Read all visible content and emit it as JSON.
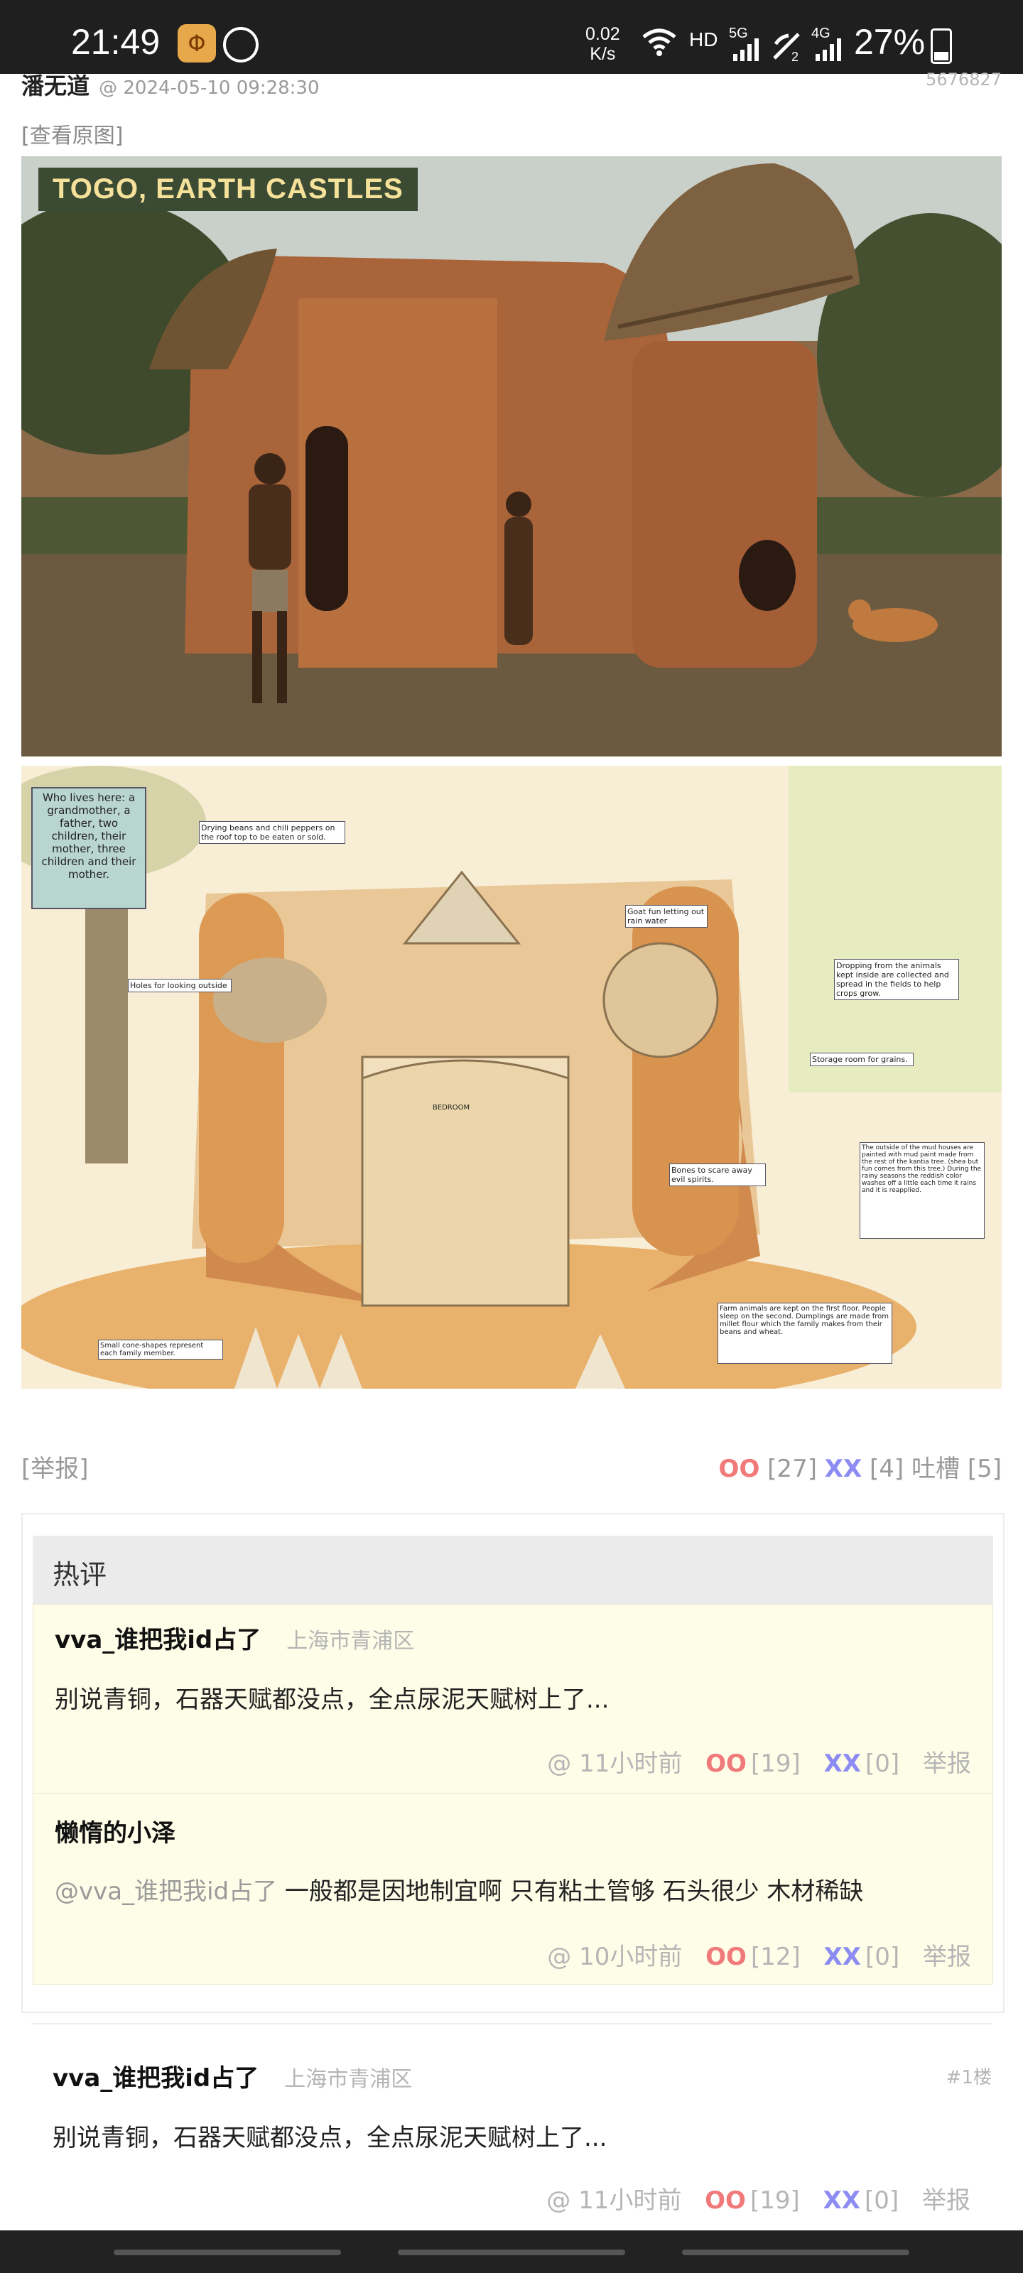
{
  "status_bar": {
    "time": "21:49",
    "net_speed_value": "0.02",
    "net_speed_unit": "K/s",
    "hd": "HD",
    "net_5g": "5G",
    "net_4g": "4G",
    "battery": "27%",
    "battery_level": 0.27
  },
  "post": {
    "author": "潘无道",
    "timestamp": "@ 2024-05-10 09:28:30",
    "post_id": "5676827",
    "view_original": "[查看原图]",
    "image_label": "TOGO, EARTH CASTLES"
  },
  "illustration": {
    "note_family": "Who lives here: a grandmother, a father, two children, their mother, three children and their mother.",
    "note_drying": "Drying beans and chili peppers on the roof top to be eaten or sold.",
    "note_holes": "Holes for looking outside",
    "note_goat": "Goat fun letting out rain water",
    "note_dropping": "Dropping from the animals kept inside are collected and spread in the fields to help crops grow.",
    "note_storage": "Storage room for grains.",
    "note_bedroom": "BEDROOM",
    "note_bones": "Bones to scare away evil spirits.",
    "note_outside": "The outside of the mud houses are painted with mud paint made from the rest of the kantia tree. (shea but fun comes from this tree.) During the rainy seasons the reddish color washes off a little each time it rains and it is reapplied.",
    "note_farm": "Farm animals are kept on the first floor. People sleep on the second. Dumplings are made from millet flour which the family makes from their beans and wheat.",
    "note_small": "Small cone-shapes represent each family member."
  },
  "actions": {
    "report": "[举报]",
    "oo_label": "OO",
    "oo_count": "[27]",
    "xx_label": "XX",
    "xx_count": "[4]",
    "tucao_label": "吐槽",
    "tucao_count": "[5]"
  },
  "hot_comments": {
    "title": "热评",
    "items": [
      {
        "author": "vva_谁把我id占了",
        "location": "上海市青浦区",
        "text": "别说青铜，石器天赋都没点，全点尿泥天赋树上了...",
        "time": "@ 11小时前",
        "oo_label": "OO",
        "oo_count": "[19]",
        "xx_label": "XX",
        "xx_count": "[0]",
        "report": "举报"
      },
      {
        "author": "懒惰的小泽",
        "mention": "@vva_谁把我id占了",
        "text": "一般都是因地制宜啊 只有粘土管够 石头很少 木材稀缺",
        "time": "@ 10小时前",
        "oo_label": "OO",
        "oo_count": "[12]",
        "xx_label": "XX",
        "xx_count": "[0]",
        "report": "举报"
      }
    ]
  },
  "comments": [
    {
      "author": "vva_谁把我id占了",
      "location": "上海市青浦区",
      "floor": "#1楼",
      "text": "别说青铜，石器天赋都没点，全点尿泥天赋树上了...",
      "time": "@ 11小时前",
      "oo_label": "OO",
      "oo_count": "[19]",
      "xx_label": "XX",
      "xx_count": "[0]",
      "report": "举报"
    }
  ]
}
